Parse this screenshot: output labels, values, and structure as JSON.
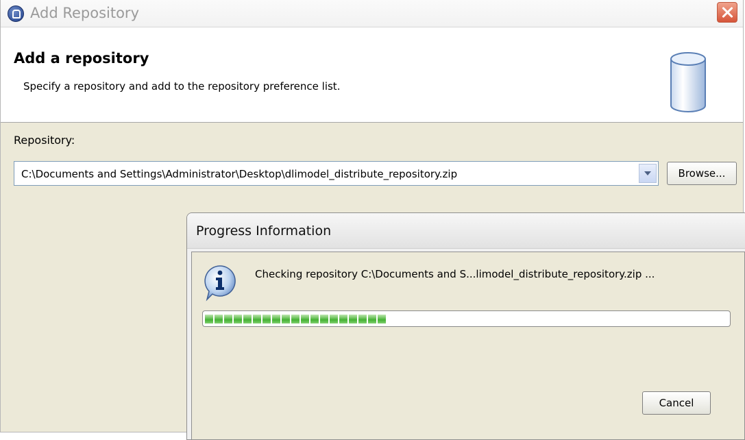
{
  "window": {
    "title": "Add Repository"
  },
  "header": {
    "title": "Add a repository",
    "description": "Specify a repository and add to the repository preference list."
  },
  "repository": {
    "label": "Repository:",
    "value": "C:\\Documents and Settings\\Administrator\\Desktop\\dlimodel_distribute_repository.zip",
    "browse_label": "Browse..."
  },
  "progress": {
    "title": "Progress Information",
    "message": "Checking repository C:\\Documents and S...limodel_distribute_repository.zip ...",
    "percent": 35,
    "cancel_label": "Cancel"
  },
  "icons": {
    "app": "repository-app-icon",
    "close": "close-icon",
    "header": "database-icon",
    "combo": "chevron-down-icon",
    "info": "info-icon"
  }
}
